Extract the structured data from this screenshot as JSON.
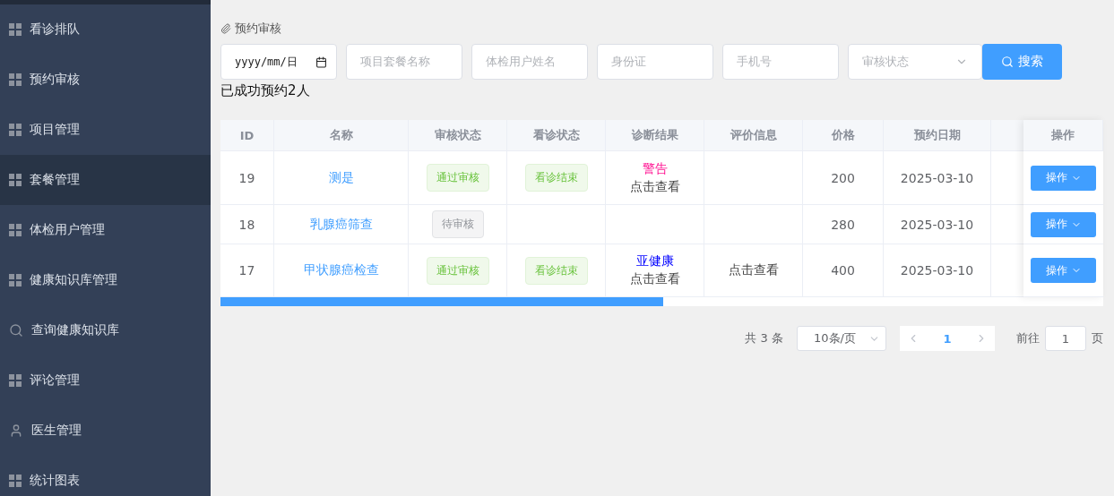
{
  "sidebar": {
    "items": [
      {
        "label": "看诊排队",
        "kind": "grid",
        "selected": false
      },
      {
        "label": "预约审核",
        "kind": "grid",
        "selected": false
      },
      {
        "label": "项目管理",
        "kind": "grid",
        "selected": false
      },
      {
        "label": "套餐管理",
        "kind": "grid",
        "selected": true
      },
      {
        "label": "体检用户管理",
        "kind": "grid",
        "selected": false
      },
      {
        "label": "健康知识库管理",
        "kind": "grid",
        "selected": false
      },
      {
        "label": "查询健康知识库",
        "kind": "search",
        "selected": false
      },
      {
        "label": "评论管理",
        "kind": "grid",
        "selected": false
      },
      {
        "label": "医生管理",
        "kind": "user",
        "selected": false
      },
      {
        "label": "统计图表",
        "kind": "grid",
        "selected": false
      }
    ]
  },
  "breadcrumb": "预约审核",
  "filters": {
    "date": "yyyy/mm/日",
    "fields": [
      "项目套餐名称",
      "体检用户姓名",
      "身份证",
      "手机号"
    ],
    "status_placeholder": "审核状态",
    "search_button": "搜索"
  },
  "message": "已成功预约2人",
  "table": {
    "columns": [
      "ID",
      "名称",
      "审核状态",
      "看诊状态",
      "诊断结果",
      "评价信息",
      "价格",
      "预约日期"
    ],
    "action_column": "操作",
    "rows": [
      {
        "id": "19",
        "name": "测是",
        "review": {
          "label": "通过审核",
          "kind": "pass"
        },
        "visit": "看诊结束",
        "diagnosis": {
          "label": "警告",
          "color": "#ff1493"
        },
        "diagnosis_link": "点击查看",
        "price": "200",
        "date": "2025-03-10",
        "action": "操作"
      },
      {
        "id": "18",
        "name": "乳腺癌筛查",
        "review": {
          "label": "待审核",
          "kind": "pending"
        },
        "price": "280",
        "date": "2025-03-10",
        "action": "操作"
      },
      {
        "id": "17",
        "name": "甲状腺癌检查",
        "review": {
          "label": "通过审核",
          "kind": "pass"
        },
        "visit": "看诊结束",
        "diagnosis": {
          "label": "亚健康",
          "color": "#0000ff"
        },
        "diagnosis_link": "点击查看",
        "evaluation": "点击查看",
        "price": "400",
        "date": "2025-03-10",
        "action": "操作"
      }
    ]
  },
  "pagination": {
    "total": "共 3 条",
    "page_size": "10条/页",
    "current": "1",
    "goto_label": "前往",
    "goto_value": "1",
    "page_suffix": "页"
  }
}
